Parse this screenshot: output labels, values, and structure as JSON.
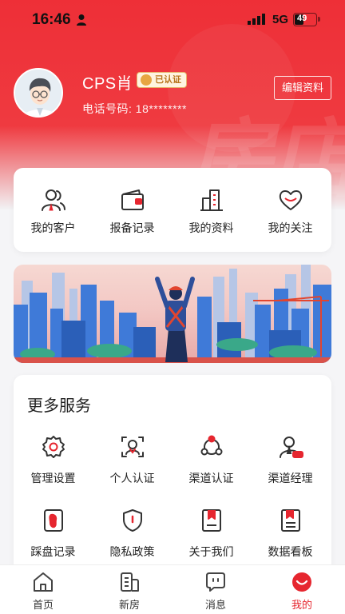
{
  "status_bar": {
    "time": "16:46",
    "network": "5G",
    "battery": "49"
  },
  "profile": {
    "name": "CPS肖",
    "badge": "已认证",
    "phone_label": "电话号码: 18********",
    "edit_label": "编辑资料"
  },
  "quick_actions": [
    {
      "label": "我的客户",
      "icon": "customer-icon"
    },
    {
      "label": "报备记录",
      "icon": "wallet-icon"
    },
    {
      "label": "我的资料",
      "icon": "building-icon"
    },
    {
      "label": "我的关注",
      "icon": "heart-icon"
    }
  ],
  "more_services": {
    "title": "更多服务",
    "items": [
      {
        "label": "管理设置",
        "icon": "gear-icon"
      },
      {
        "label": "个人认证",
        "icon": "face-scan-icon"
      },
      {
        "label": "渠道认证",
        "icon": "network-icon"
      },
      {
        "label": "渠道经理",
        "icon": "manager-icon"
      },
      {
        "label": "踩盘记录",
        "icon": "footprint-icon"
      },
      {
        "label": "隐私政策",
        "icon": "shield-icon"
      },
      {
        "label": "关于我们",
        "icon": "bookmark-icon"
      },
      {
        "label": "数据看板",
        "icon": "dashboard-icon"
      }
    ]
  },
  "tab_bar": [
    {
      "label": "首页",
      "icon": "home-icon"
    },
    {
      "label": "新房",
      "icon": "building-tab-icon"
    },
    {
      "label": "消息",
      "icon": "message-icon"
    },
    {
      "label": "我的",
      "icon": "profile-tab-icon",
      "active": true
    }
  ],
  "colors": {
    "brand_red": "#e6262f",
    "badge_gold": "#e7a641"
  }
}
